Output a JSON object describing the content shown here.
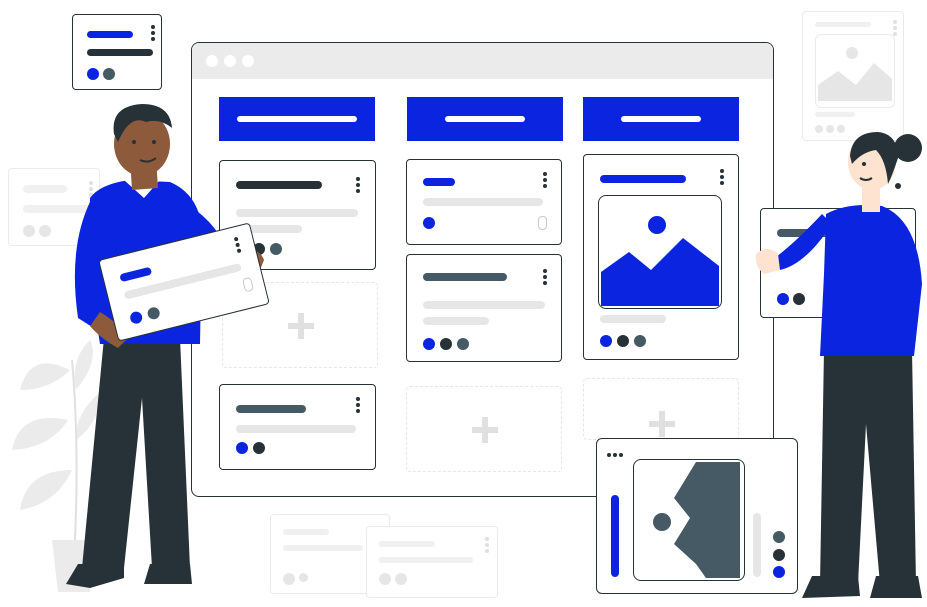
{
  "scene": {
    "type": "kanban board illustration",
    "colors": {
      "accent": "#0b24e0",
      "dark": "#263238",
      "slate": "#455a64",
      "placeholder": "#e6e6e6",
      "window_chrome": "#ebebeb"
    }
  },
  "window": {
    "controls": [
      "dot",
      "dot",
      "dot"
    ]
  },
  "board": {
    "columns": [
      {
        "id": "column-1",
        "cards": 2,
        "empty_slots": 1
      },
      {
        "id": "column-2",
        "cards": 2,
        "empty_slots": 1
      },
      {
        "id": "column-3",
        "cards": 1,
        "empty_slots": 1
      }
    ],
    "icons": {
      "add": "plus-icon",
      "menu": "kebab-menu-icon",
      "attachment": "paperclip-icon",
      "image": "image-placeholder-icon"
    }
  },
  "people": [
    {
      "id": "man",
      "holding": "task-card"
    },
    {
      "id": "woman",
      "holding": "task-card"
    }
  ]
}
